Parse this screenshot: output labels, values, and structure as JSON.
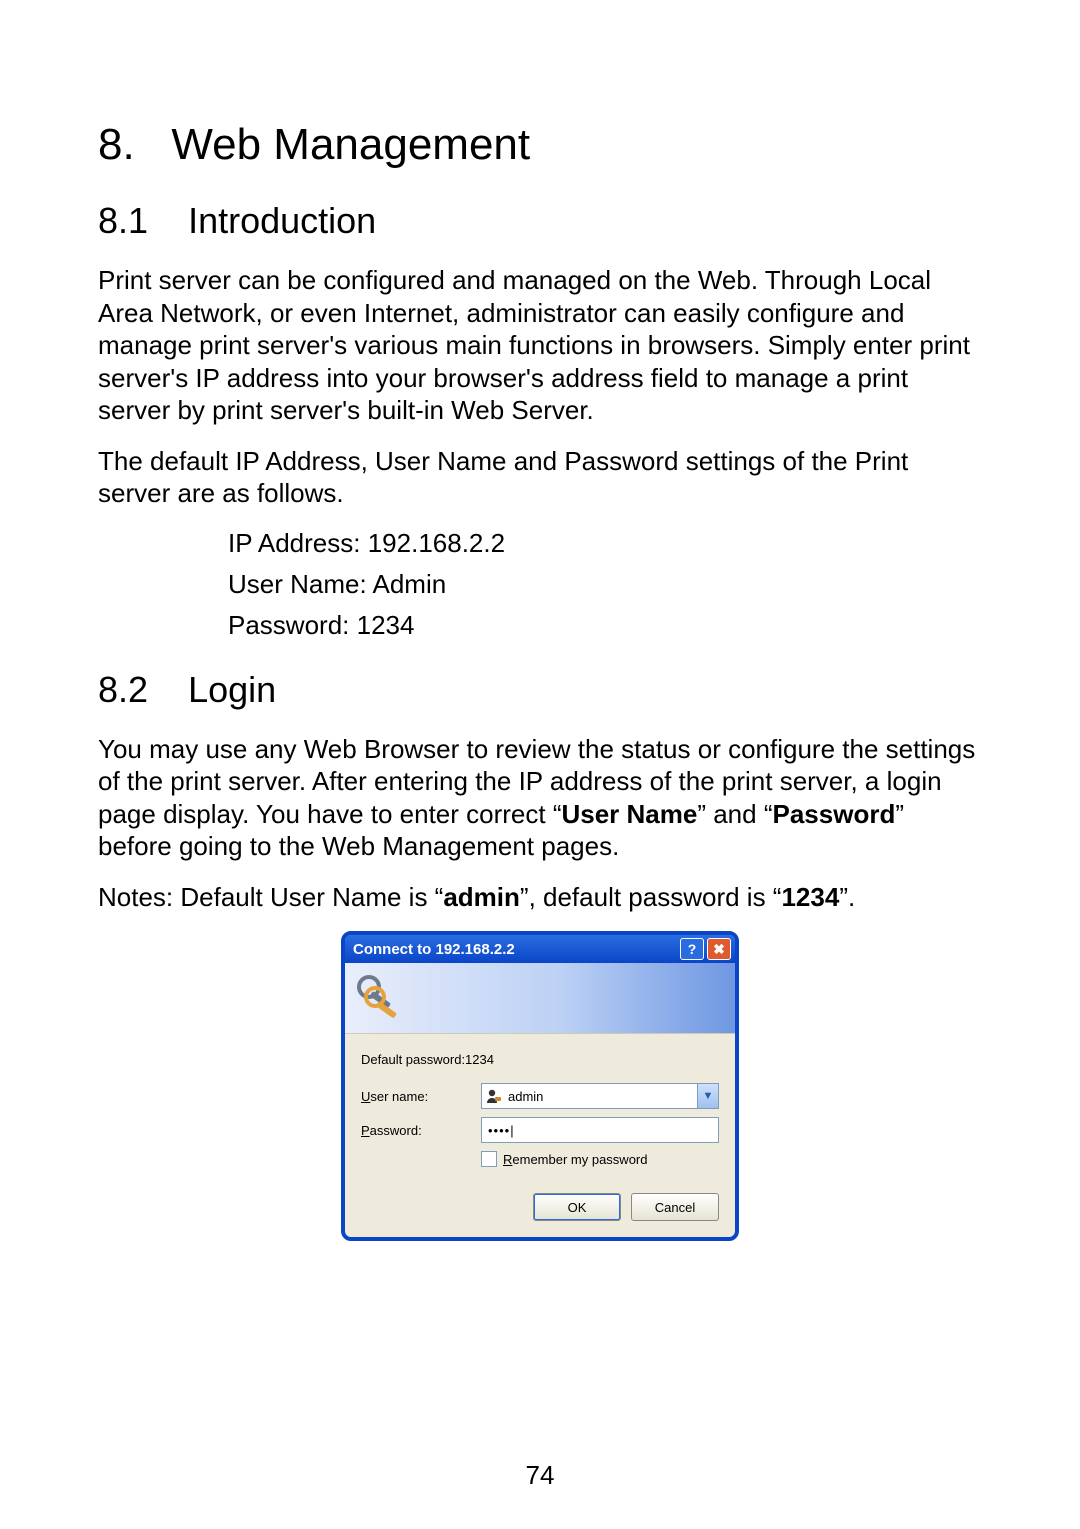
{
  "heading": {
    "chapter_num": "8.",
    "chapter_title": "Web Management",
    "section1_num": "8.1",
    "section1_title": "Introduction",
    "section2_num": "8.2",
    "section2_title": "Login"
  },
  "intro": {
    "p1": "Print server can be configured and managed on the Web. Through Local Area Network, or even Internet, administrator can easily configure and manage print server's various main functions in browsers. Simply enter print server's IP address into your browser's address field to manage a print server by print server's built-in Web Server.",
    "p2": "The default IP Address, User Name and Password settings of the Print server are as follows.",
    "defaults": {
      "ip": "IP Address: 192.168.2.2",
      "user": "User Name: Admin",
      "pass": "Password: 1234"
    }
  },
  "login": {
    "p1_pre": "You may use any Web Browser to review the status or configure the settings of the print server. After entering the IP address of the print server, a login page display. You have to enter correct “",
    "p1_b1": "User Name",
    "p1_mid": "” and “",
    "p1_b2": "Password",
    "p1_post": "” before going to the Web Management pages.",
    "notes_pre": "Notes: Default User Name is “",
    "notes_b1": "admin",
    "notes_mid": "”, default password is “",
    "notes_b2": "1234",
    "notes_post": "”."
  },
  "dialog": {
    "title": "Connect to 192.168.2.2",
    "help_glyph": "?",
    "close_glyph": "✖",
    "realm_text": "Default password:1234",
    "user_label_u": "U",
    "user_label_rest": "ser name:",
    "pass_label_u": "P",
    "pass_label_rest": "assword:",
    "user_value": "admin",
    "pass_masked": "••••|",
    "remember_u": "R",
    "remember_rest": "emember my password",
    "ok": "OK",
    "cancel": "Cancel",
    "dd_glyph": "▼"
  },
  "page_number": "74"
}
